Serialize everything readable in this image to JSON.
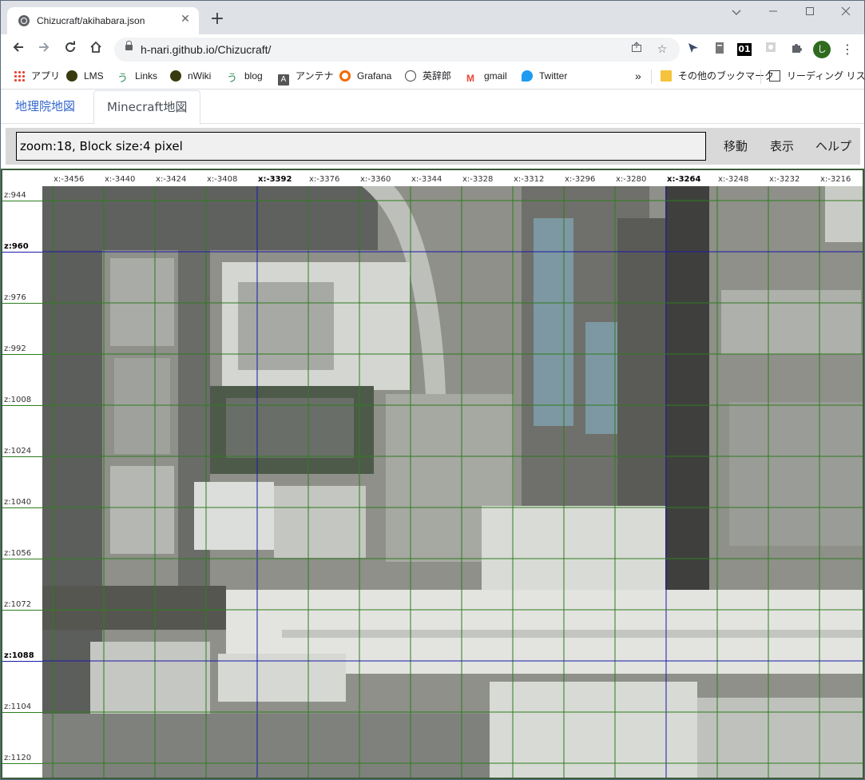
{
  "browser": {
    "tab_title": "Chizucraft/akihabara.json",
    "tab_close": "✕",
    "new_tab": "+",
    "url": "h-nari.github.io/Chizucraft/",
    "bookmarks": [
      {
        "label": "アプリ",
        "icon": "apps-grid-icon"
      },
      {
        "label": "LMS",
        "icon": "lms-icon"
      },
      {
        "label": "Links",
        "icon": "links-icon"
      },
      {
        "label": "nWiki",
        "icon": "nwiki-icon"
      },
      {
        "label": "blog",
        "icon": "blog-icon"
      },
      {
        "label": "アンテナ",
        "icon": "antenna-icon"
      },
      {
        "label": "Grafana",
        "icon": "grafana-icon"
      },
      {
        "label": "英辞郎",
        "icon": "eijiro-icon"
      },
      {
        "label": "gmail",
        "icon": "gmail-icon"
      },
      {
        "label": "Twitter",
        "icon": "twitter-icon"
      }
    ],
    "bookmarks_overflow": "»",
    "other_bookmarks": "その他のブックマーク",
    "reading_list": "リーディング リスト",
    "profile_initial": "し",
    "ext_badge": "01"
  },
  "page": {
    "tabs": {
      "gsi": "地理院地図",
      "minecraft": "Minecraft地図"
    },
    "status_field": "zoom:18, Block size:4 pixel",
    "buttons": {
      "move": "移動",
      "show": "表示",
      "help": "ヘルプ"
    }
  },
  "map": {
    "x_labels": [
      "x:-3456",
      "x:-3440",
      "x:-3424",
      "x:-3408",
      "x:-3392",
      "x:-3376",
      "x:-3360",
      "x:-3344",
      "x:-3328",
      "x:-3312",
      "x:-3296",
      "x:-3280",
      "x:-3264",
      "x:-3248",
      "x:-3232",
      "x:-3216"
    ],
    "x_bold": [
      "x:-3392",
      "x:-3264"
    ],
    "z_labels": [
      "z:944",
      "z:960",
      "z:976",
      "z:992",
      "z:1008",
      "z:1024",
      "z:1040",
      "z:1056",
      "z:1072",
      "z:1088",
      "z:1104",
      "z:1120"
    ],
    "z_bold": [
      "z:960",
      "z:1088"
    ],
    "colors": {
      "grid": "#2e7d1e",
      "major_grid": "#1a1aa8"
    }
  }
}
